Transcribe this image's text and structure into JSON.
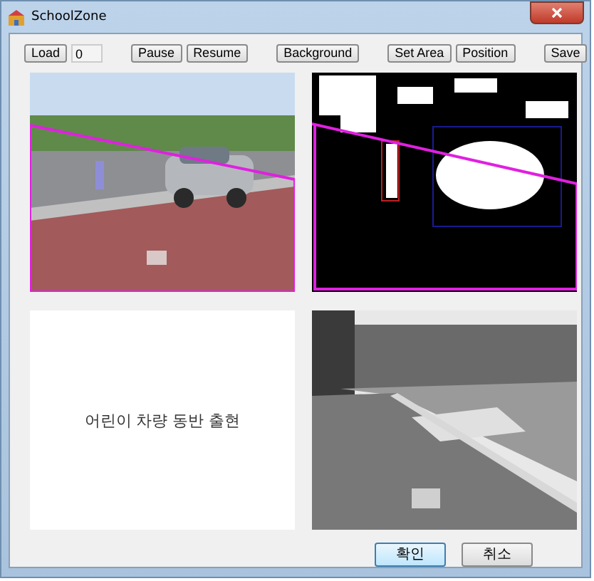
{
  "window": {
    "title": "SchoolZone"
  },
  "toolbar": [
    [
      {
        "kind": "button",
        "label": "Load"
      },
      {
        "kind": "field",
        "value": "0"
      }
    ],
    [
      {
        "kind": "button",
        "label": "Pause"
      },
      {
        "kind": "button",
        "label": "Resume"
      }
    ],
    [
      {
        "kind": "button",
        "label": "Background"
      }
    ],
    [
      {
        "kind": "button",
        "label": "Set Area"
      },
      {
        "kind": "button",
        "label": "Position"
      }
    ],
    [
      {
        "kind": "button",
        "label": "Save"
      }
    ]
  ],
  "panels": [
    {
      "kind": "picture"
    },
    {
      "kind": "picture"
    },
    {
      "kind": "message",
      "text": "어린이 차량 동반 출현"
    },
    {
      "kind": "picture"
    }
  ],
  "buttons": [
    {
      "label": "확인",
      "default": true
    },
    {
      "label": "취소",
      "default": false
    }
  ]
}
